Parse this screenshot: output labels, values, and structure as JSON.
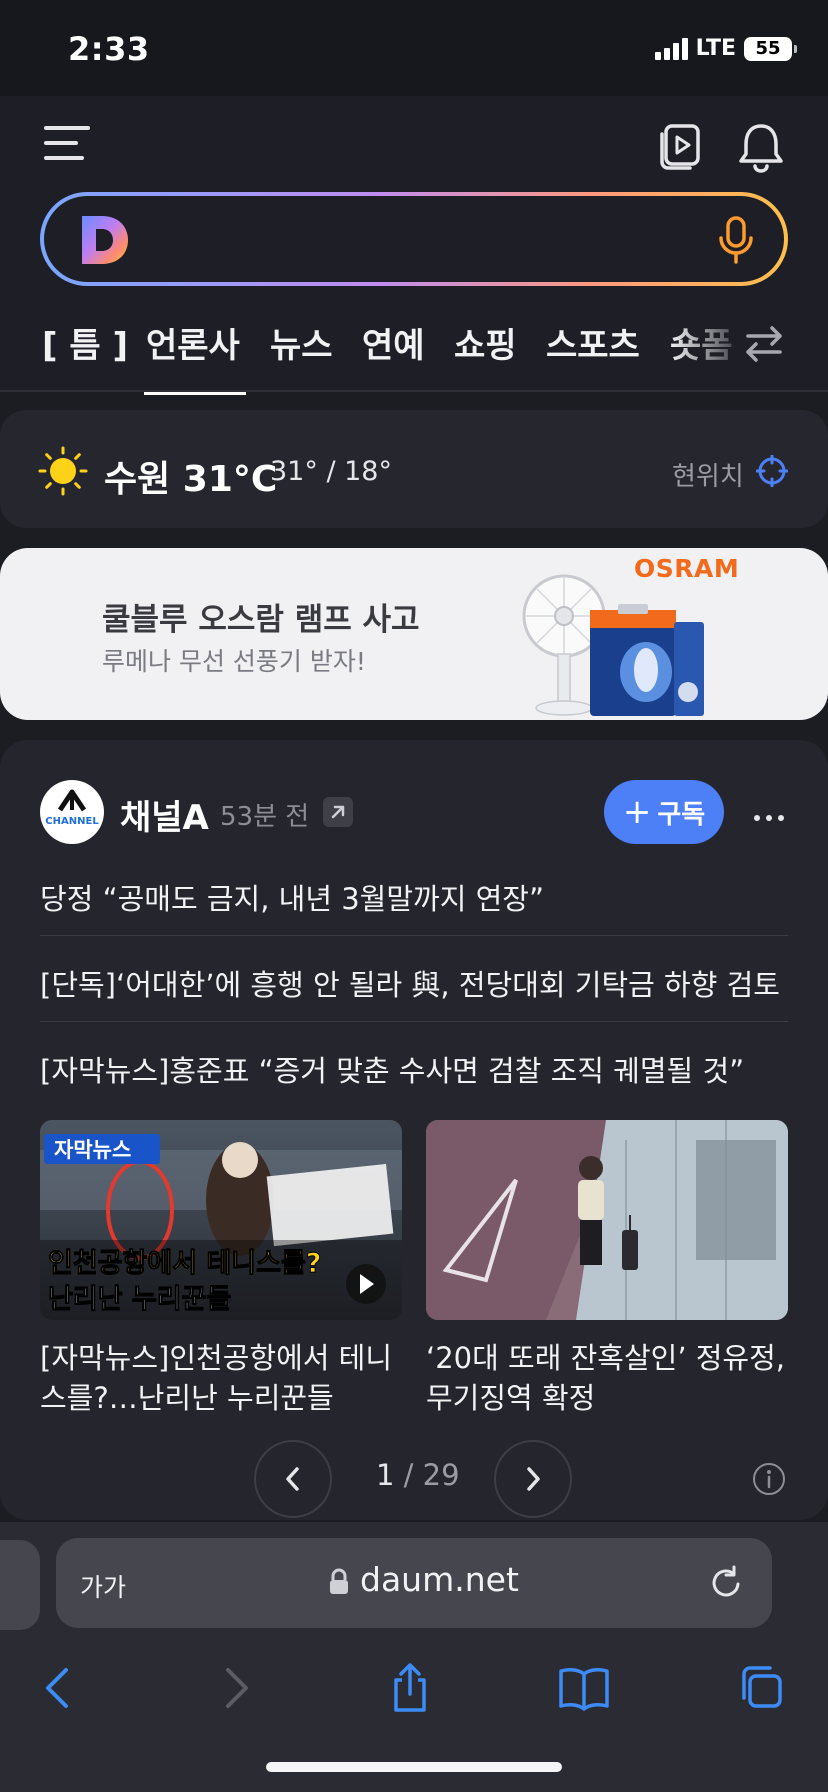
{
  "status_bar": {
    "time": "2:33",
    "network": "LTE",
    "battery": "55"
  },
  "header": {
    "icons": [
      "menu-icon",
      "video-icon",
      "bell-icon"
    ],
    "search": {
      "placeholder": "",
      "logo": "D"
    },
    "tabs": [
      {
        "label": "[ 틈 ]"
      },
      {
        "label": "언론사",
        "active": true
      },
      {
        "label": "뉴스"
      },
      {
        "label": "연예"
      },
      {
        "label": "쇼핑"
      },
      {
        "label": "스포츠"
      },
      {
        "label": "숏폼"
      }
    ]
  },
  "weather": {
    "city_temp": "수원 31°C",
    "range": "31° / 18°",
    "location_label": "현위치"
  },
  "ad": {
    "title": "쿨블루 오스람 램프 사고",
    "subtitle": "루메나 무선 선풍기 받자!",
    "brand": "OSRAM"
  },
  "news": {
    "channel_name": "채널A",
    "channel_logo_text": "CHANNEL",
    "time_ago": "53분 전",
    "subscribe_label": "구독",
    "headlines": [
      "당정 “공매도 금지, 내년 3월말까지 연장”",
      "[단독]‘어대한’에 흥행 안 될라 與, 전당대회 기탁금 하향 검토",
      "[자막뉴스]홍준표 “증거 맞춘 수사면 검찰 조직 궤멸될 것”"
    ],
    "cards": [
      {
        "caption": "[자막뉴스]인천공항에서 테니스를?…난리난 누리꾼들",
        "overlay_tag": "자막뉴스",
        "overlay_line1": "인천공항에서 테니스를?",
        "overlay_line2": "난리난 누리꾼들"
      },
      {
        "caption": "‘20대 또래 잔혹살인’ 정유정, 무기징역 확정"
      }
    ],
    "pager": {
      "current": "1",
      "total": "29"
    }
  },
  "browser": {
    "text_size": "가가",
    "url": "daum.net"
  },
  "colors": {
    "background": "#1c1d23",
    "card": "#25262d",
    "accent_blue": "#4d7ff7",
    "sun": "#ffd21a",
    "osram": "#f26a1b"
  }
}
